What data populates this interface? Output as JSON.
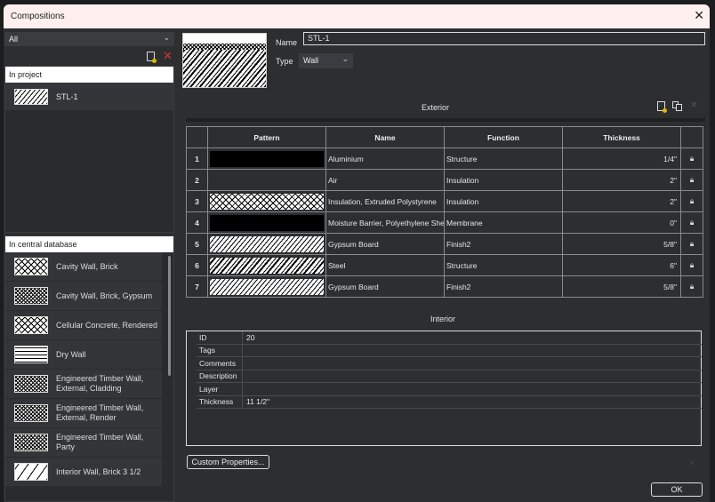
{
  "window": {
    "title": "Compositions",
    "close": "✕"
  },
  "filter": {
    "value": "All"
  },
  "left": {
    "in_project_header": "In project",
    "project_items": [
      {
        "label": "STL-1"
      }
    ],
    "central_header": "In central database",
    "central_items": [
      {
        "label": "Cavity Wall, Brick"
      },
      {
        "label": "Cavity Wall, Brick, Gypsum"
      },
      {
        "label": "Cellular Concrete, Rendered"
      },
      {
        "label": "Dry Wall"
      },
      {
        "label": "Engineered Timber Wall, External, Cladding"
      },
      {
        "label": "Engineered Timber Wall, External, Render"
      },
      {
        "label": "Engineered Timber Wall, Party"
      },
      {
        "label": "Interior Wall, Brick 3 1/2"
      }
    ]
  },
  "form": {
    "name_label": "Name",
    "name_value": "STL-1",
    "type_label": "Type",
    "type_value": "Wall"
  },
  "exterior_label": "Exterior",
  "interior_label": "Interior",
  "table": {
    "headers": [
      "Pattern",
      "Name",
      "Function",
      "Thickness"
    ],
    "rows": [
      {
        "idx": "1",
        "pattern": "solid",
        "name": "Aluminium",
        "function": "Structure",
        "thickness": "1/4\""
      },
      {
        "idx": "2",
        "pattern": "none",
        "name": "Air",
        "function": "Insulation",
        "thickness": "2\""
      },
      {
        "idx": "3",
        "pattern": "cross",
        "name": "Insulation, Extruded Polystyrene",
        "function": "Insulation",
        "thickness": "2\""
      },
      {
        "idx": "4",
        "pattern": "solid",
        "name": "Moisture Barrier, Polyethylene Sheet",
        "function": "Membrane",
        "thickness": "0\""
      },
      {
        "idx": "5",
        "pattern": "diag",
        "name": "Gypsum Board",
        "function": "Finish2",
        "thickness": "5/8\""
      },
      {
        "idx": "6",
        "pattern": "diag2",
        "name": "Steel",
        "function": "Structure",
        "thickness": "6\""
      },
      {
        "idx": "7",
        "pattern": "diag",
        "name": "Gypsum Board",
        "function": "Finish2",
        "thickness": "5/8\""
      }
    ]
  },
  "properties": [
    {
      "key": "ID",
      "value": "20"
    },
    {
      "key": "Tags",
      "value": ""
    },
    {
      "key": "Comments",
      "value": ""
    },
    {
      "key": "Description",
      "value": ""
    },
    {
      "key": "Layer",
      "value": ""
    },
    {
      "key": "Thickness",
      "value": "11 1/2\""
    }
  ],
  "buttons": {
    "custom_properties": "Custom Properties...",
    "ok": "OK"
  }
}
